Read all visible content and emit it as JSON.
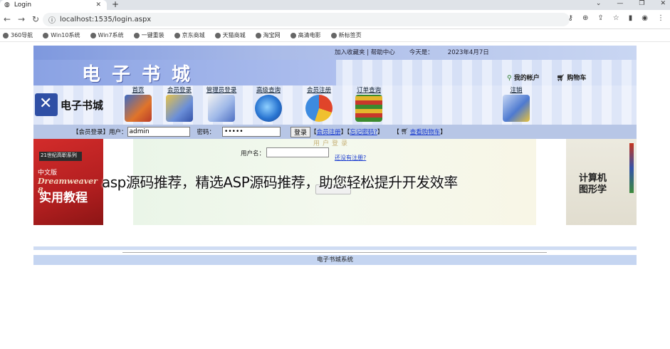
{
  "browser": {
    "tab_title": "Login",
    "tab_close": "✕",
    "new_tab": "+",
    "url": "localhost:1535/login.aspx",
    "bookmarks": [
      "360导航",
      "Win10系统",
      "Win7系统",
      "一键重装",
      "京东商城",
      "天猫商城",
      "淘宝网",
      "高清电影",
      "新标签页"
    ]
  },
  "site": {
    "top_links": [
      "加入收藏夹 | 帮助中心",
      "今天是：",
      "2023年4月7日"
    ],
    "brand_big": "电子书城",
    "logo_text": "电子书城",
    "account": {
      "my_account": "我的帐户",
      "cart": "购物车"
    },
    "nav": [
      "首页",
      "会员登录",
      "管理员登录",
      "高级查询",
      "会员注册",
      "订单查询",
      "注销"
    ]
  },
  "login_bar": {
    "section_label": "【会员登录】用户：",
    "username_value": "admin",
    "password_label": "密码：",
    "password_value": "•••••",
    "login_button": "登录",
    "register_link": "会员注册",
    "forgot_link": "忘记密码?",
    "cart_link": "查看购物车",
    "bracket_open": "【",
    "bracket_sep": "】【",
    "bracket_close": "】",
    "bracket_cart_open": "【"
  },
  "content": {
    "panel_title": "用户登录",
    "username_label": "用户名：",
    "register_link": "还没有注册?",
    "left_book": {
      "small": "21世纪高职系列",
      "cn": "中文版",
      "dw": "Dreamweaver 8",
      "title": "实用教程"
    },
    "right_book": {
      "title_line1": "计算机",
      "title_line2": "图形学"
    }
  },
  "footer": {
    "text": "电子书城系统"
  },
  "overlay_text": "asp源码推荐，精选ASP源码推荐，助您轻松提升开发效率"
}
